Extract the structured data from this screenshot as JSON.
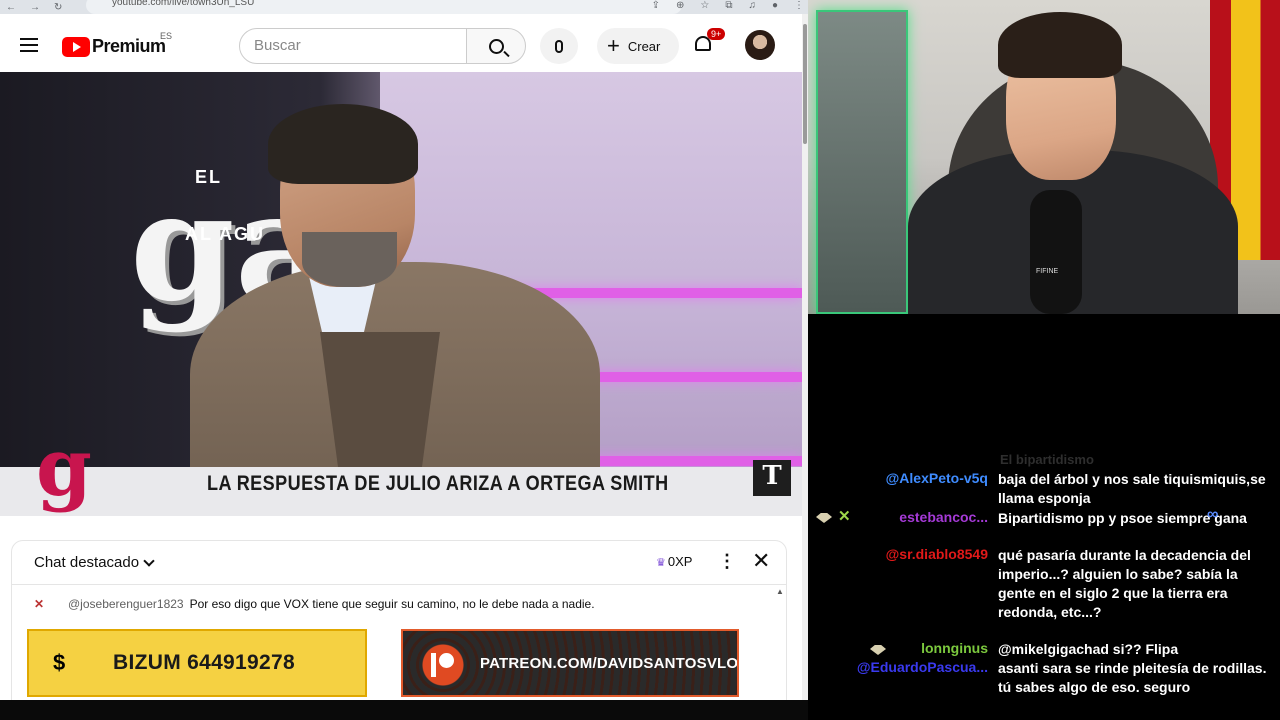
{
  "browser": {
    "url": "youtube.com/live/towh3Un_LSU"
  },
  "header": {
    "brand": "Premium",
    "region": "ES",
    "search_placeholder": "Buscar",
    "create_label": "Crear",
    "notifications_badge": "9+"
  },
  "video": {
    "logo_el": "EL",
    "logo_g": "gat",
    "logo_al": "AL AGU",
    "caption": "LA RESPUESTA DE JULIO ARIZA A ORTEGA SMITH",
    "corner_logo": "T"
  },
  "chat": {
    "title": "Chat destacado",
    "xp": "0XP",
    "messages": [
      {
        "author": "@joseberenguer1823",
        "text": "Por eso digo que VOX tiene que seguir su camino, no le debe nada a nadie."
      }
    ]
  },
  "banners": {
    "bizum": "BIZUM 644919278",
    "patreon": "PATREON.COM/DAVIDSANTOSVLOG"
  },
  "webcam": {
    "mic_brand": "FIFINE"
  },
  "overlay_chat": {
    "faded": "El bipartidismo",
    "messages": [
      {
        "author": "@AlexPeto-v5q",
        "color": "#3f8cff",
        "text": "baja del árbol y nos sale tiquismiquis,se llama esponja"
      },
      {
        "author": "estebancoc...",
        "color": "#a53ad6",
        "text": "Bipartidismo pp y psoe siempre gana"
      },
      {
        "author": "@sr.diablo8549",
        "color": "#e01919",
        "text": "qué pasaría durante la decadencia del imperio...? alguien lo sabe? sabía la gente en el siglo 2 que la tierra era redonda, etc...?"
      },
      {
        "author": "lonnginus",
        "color": "#7cc93e",
        "text": "@mikelgigachad si?? Flipa"
      },
      {
        "author": "@EduardoPascua...",
        "color": "#3a3aef",
        "text": "asanti sara se rinde pleitesía de rodillas. tú sabes algo de eso. seguro"
      }
    ]
  }
}
